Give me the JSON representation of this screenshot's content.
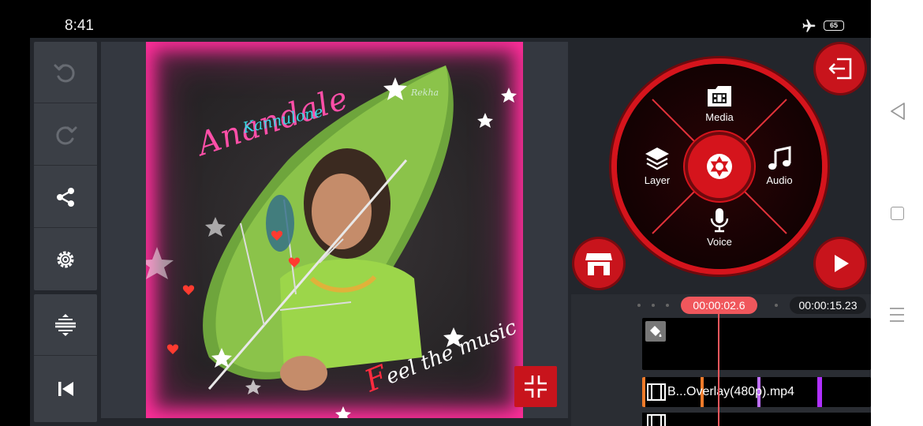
{
  "status": {
    "time": "8:41",
    "battery": "65"
  },
  "preview": {
    "title": "Anandale",
    "subtitle": "Kannulone",
    "caption_first": "F",
    "caption_rest": "eel the music",
    "signature": "Rekha"
  },
  "wheel": {
    "media_label": "Media",
    "layer_label": "Layer",
    "audio_label": "Audio",
    "voice_label": "Voice"
  },
  "timeline": {
    "current_time": "00:00:02.6",
    "total_time": "00:00:15.23",
    "clip_label": "B...Overlay(480p).mp4",
    "playhead_fraction": 0.17
  },
  "colors": {
    "accent": "#d5141c",
    "playhead": "#f0575c",
    "frame_glow": "#ff2e9a"
  },
  "icons": [
    "undo-icon",
    "redo-icon",
    "share-icon",
    "settings-icon",
    "trim-icon",
    "skip-to-start-icon",
    "collapse-icon",
    "exit-icon",
    "store-icon",
    "play-icon",
    "media-icon",
    "layer-icon",
    "audio-icon",
    "voice-icon",
    "camera-shutter-icon",
    "fill-bucket-icon"
  ]
}
